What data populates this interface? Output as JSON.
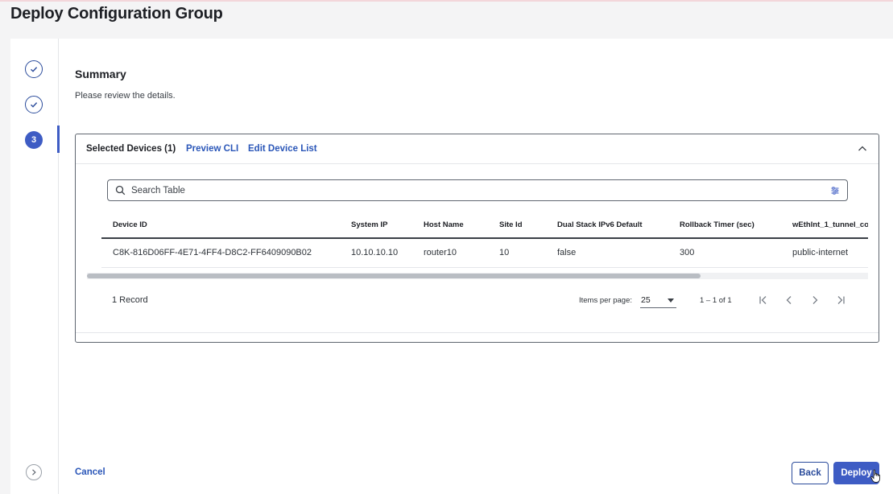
{
  "page": {
    "title": "Deploy Configuration Group"
  },
  "stepper": {
    "steps": [
      {
        "state": "done"
      },
      {
        "state": "done"
      },
      {
        "state": "current",
        "label": "3"
      }
    ]
  },
  "summary": {
    "title": "Summary",
    "subtitle": "Please review the details."
  },
  "card": {
    "title": "Selected Devices (1)",
    "links": {
      "preview_cli": "Preview CLI",
      "edit_device_list": "Edit Device List"
    }
  },
  "search": {
    "placeholder": "Search Table",
    "value": ""
  },
  "table": {
    "columns": [
      "Device ID",
      "System IP",
      "Host Name",
      "Site Id",
      "Dual Stack IPv6 Default",
      "Rollback Timer (sec)",
      "wEthInt_1_tunnel_co"
    ],
    "rows": [
      [
        "C8K-816D06FF-4E71-4FF4-D8C2-FF6409090B02",
        "10.10.10.10",
        "router10",
        "10",
        "false",
        "300",
        "public-internet"
      ]
    ]
  },
  "pagination": {
    "record_count": "1 Record",
    "items_per_page_label": "Items per page:",
    "items_per_page_value": "25",
    "range": "1 – 1 of 1"
  },
  "actions": {
    "cancel": "Cancel",
    "back": "Back",
    "deploy": "Deploy"
  },
  "colors": {
    "primary": "#3e5cc4",
    "link": "#2a56b8",
    "border": "#5f6670"
  },
  "icons": {
    "step_done": "check-icon",
    "collapse": "chevron-up-icon",
    "search": "search-icon",
    "filter": "filter-settings-icon",
    "nav": "chevron-right-icon",
    "first": "first-page-icon",
    "prev": "chevron-left-icon",
    "next": "chevron-right-icon",
    "last": "last-page-icon"
  }
}
